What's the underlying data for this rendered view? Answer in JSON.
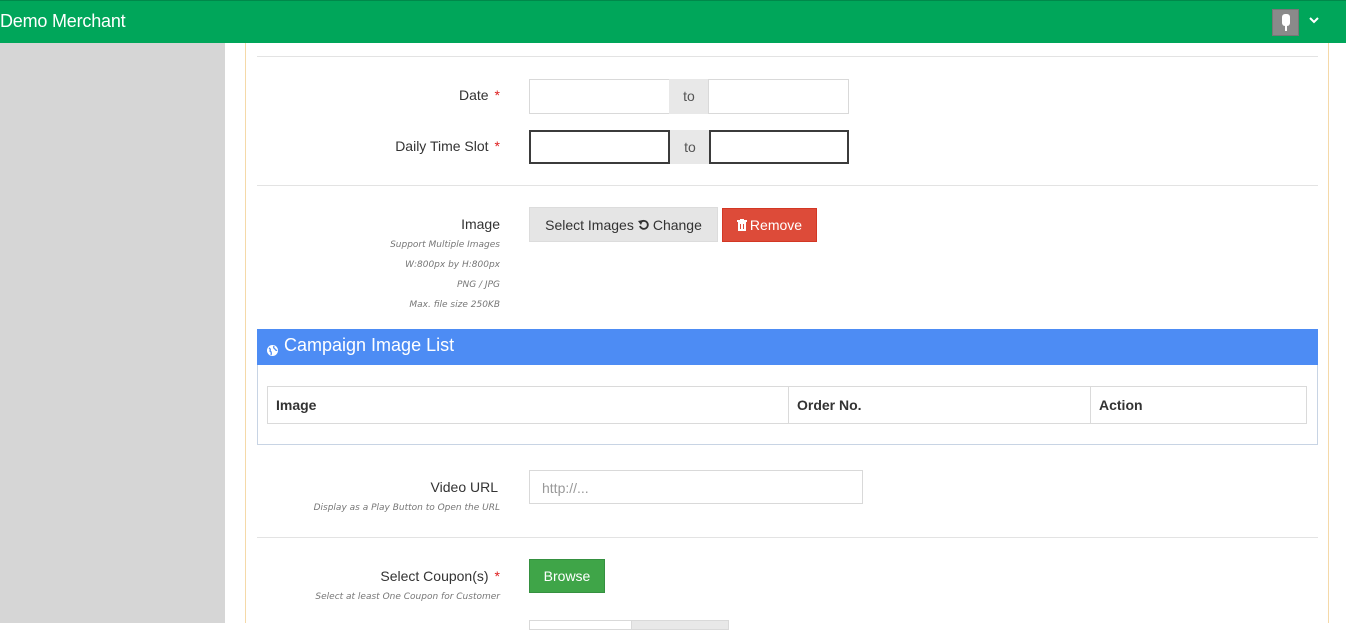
{
  "header": {
    "brand": "Demo Merchant"
  },
  "form": {
    "date": {
      "label": "Date",
      "required_mark": "*",
      "to_label": "to"
    },
    "time_slot": {
      "label": "Daily Time Slot",
      "required_mark": "*",
      "to_label": "to"
    },
    "image": {
      "label": "Image",
      "help": [
        "Support Multiple Images",
        "W:800px by H:800px",
        "PNG / JPG",
        "Max. file size 250KB"
      ],
      "select_label": "Select Images",
      "change_label": "Change",
      "remove_label": "Remove"
    },
    "image_list": {
      "title": "Campaign Image List",
      "columns": [
        "Image",
        "Order No.",
        "Action"
      ]
    },
    "video": {
      "label": "Video URL",
      "help": "Display as a Play Button to Open the URL",
      "placeholder": "http://..."
    },
    "coupons": {
      "label": "Select Coupon(s)",
      "required_mark": "*",
      "help": "Select at least One Coupon for Customer",
      "browse_label": "Browse"
    }
  },
  "colors": {
    "topbar": "#00a65a",
    "box_header": "#4d8cf4",
    "danger": "#dd4b39",
    "success": "#3fa548"
  },
  "icons": [
    "user-avatar-icon",
    "chevron-down-icon",
    "undo-icon",
    "trash-icon",
    "globe-icon"
  ]
}
